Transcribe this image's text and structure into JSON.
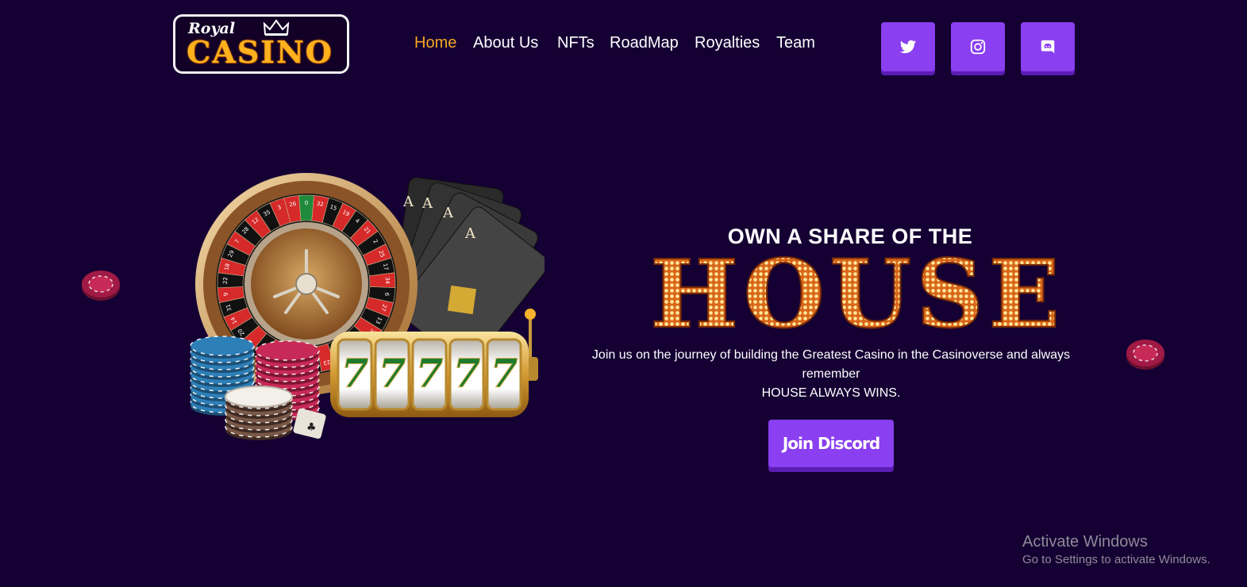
{
  "logo": {
    "small": "Royal",
    "big": "CASINO"
  },
  "nav": {
    "items": [
      {
        "label": "Home",
        "active": true
      },
      {
        "label": "About Us"
      },
      {
        "label": "NFTs"
      },
      {
        "label": "RoadMap"
      },
      {
        "label": "Royalties"
      },
      {
        "label": "Team"
      }
    ]
  },
  "social": [
    {
      "icon": "twitter-icon"
    },
    {
      "icon": "instagram-icon"
    },
    {
      "icon": "discord-icon"
    }
  ],
  "hero": {
    "kicker": "OWN A SHARE OF THE",
    "headline": "HOUSE",
    "description_line1": "Join us on the journey of building the Greatest Casino in the Casinoverse and always remember",
    "description_line2": "HOUSE ALWAYS WINS.",
    "cta": "Join Discord"
  },
  "art": {
    "slot_digits": "77777",
    "card_rank": "A",
    "roulette_numbers": [
      "26",
      "0",
      "32",
      "15",
      "19",
      "4",
      "21",
      "2",
      "25",
      "17",
      "34",
      "6",
      "27",
      "13",
      "36",
      "11",
      "30",
      "8",
      "23",
      "10",
      "5",
      "24",
      "16",
      "33",
      "1",
      "20",
      "14",
      "31",
      "9",
      "22",
      "18",
      "29",
      "7",
      "28",
      "12",
      "35",
      "3"
    ]
  },
  "watermark": {
    "title": "Activate Windows",
    "subtitle": "Go to Settings to activate Windows."
  },
  "colors": {
    "background": "#150033",
    "accent": "#8a3ff0",
    "active_nav": "#f5a623",
    "gold": "#ffb21e"
  }
}
